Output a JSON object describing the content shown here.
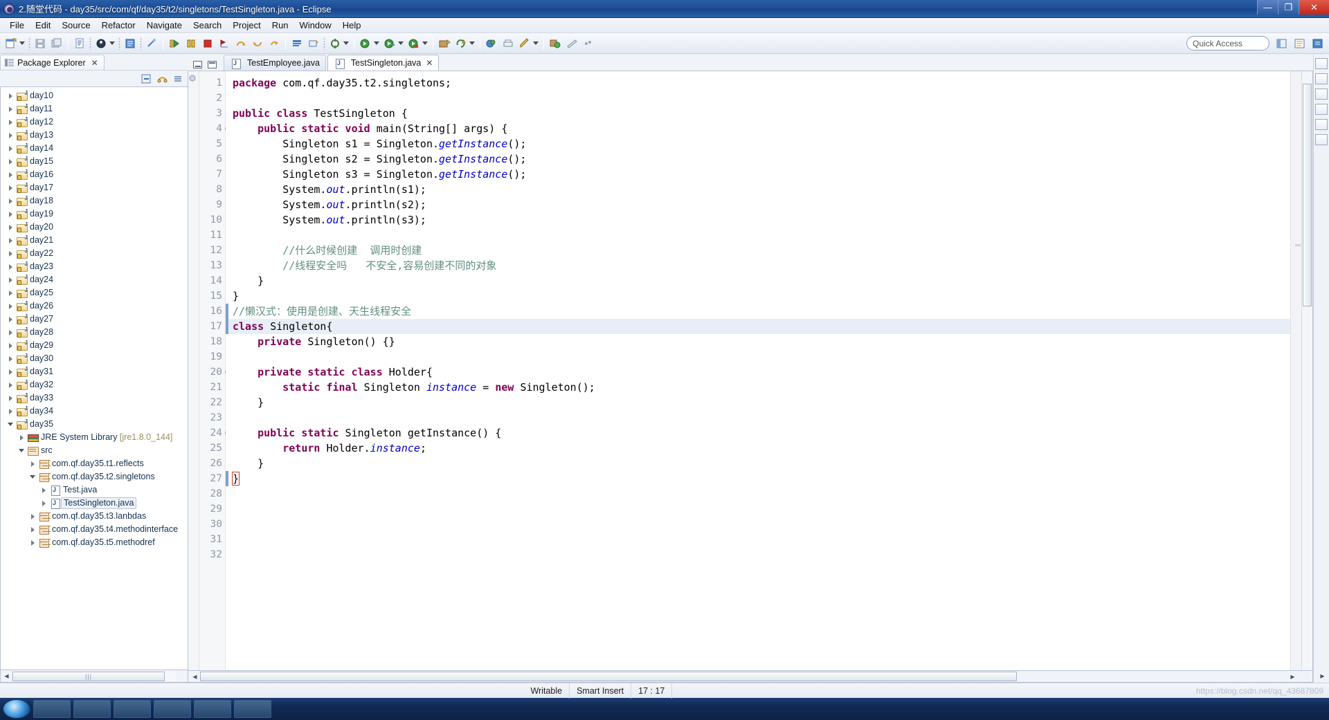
{
  "window": {
    "title": "2.随堂代码 - day35/src/com/qf/day35/t2/singletons/TestSingleton.java - Eclipse",
    "minimize_label": "—",
    "maximize_label": "❐",
    "close_label": "✕"
  },
  "menu": {
    "items": [
      "File",
      "Edit",
      "Source",
      "Refactor",
      "Navigate",
      "Search",
      "Project",
      "Run",
      "Window",
      "Help"
    ]
  },
  "toolbar": {
    "quick_access_placeholder": "Quick Access",
    "icons": [
      "new-wizard-icon",
      "save-icon",
      "save-all-icon",
      "new-java-file-icon",
      "java-perspective-icon",
      "new-class-icon",
      "link-icon",
      "debug-icon",
      "step-icon",
      "terminate-icon",
      "next-annotation-icon",
      "back-icon",
      "forward-icon",
      "refresh-icon",
      "external-tools-icon",
      "build-icon",
      "search-icon",
      "run-icon",
      "run-last-icon",
      "coverage-icon",
      "open-type-icon",
      "open-task-icon",
      "pin-icon",
      "print-icon",
      "edit-icon",
      "open-perspective-icon",
      "ruler-icon",
      "profile-icon",
      "outline-icon",
      "properties-icon",
      "console-icon"
    ],
    "perspective_buttons": [
      "open-perspective-icon",
      "java-perspective-icon",
      "java-ee-perspective-icon"
    ]
  },
  "package_explorer": {
    "title": "Package Explorer",
    "close_label": "✕",
    "view_toolbar": [
      "collapse-all-icon",
      "link-with-editor-icon",
      "view-menu-icon"
    ],
    "tree": [
      {
        "label": "day10",
        "icon": "java-project-icon",
        "indent": 0,
        "state": "collapsed"
      },
      {
        "label": "day11",
        "icon": "java-project-icon",
        "indent": 0,
        "state": "collapsed"
      },
      {
        "label": "day12",
        "icon": "java-project-icon",
        "indent": 0,
        "state": "collapsed"
      },
      {
        "label": "day13",
        "icon": "java-project-icon",
        "indent": 0,
        "state": "collapsed"
      },
      {
        "label": "day14",
        "icon": "java-project-icon",
        "indent": 0,
        "state": "collapsed"
      },
      {
        "label": "day15",
        "icon": "java-project-icon",
        "indent": 0,
        "state": "collapsed"
      },
      {
        "label": "day16",
        "icon": "java-project-icon",
        "indent": 0,
        "state": "collapsed"
      },
      {
        "label": "day17",
        "icon": "java-project-icon",
        "indent": 0,
        "state": "collapsed"
      },
      {
        "label": "day18",
        "icon": "java-project-icon",
        "indent": 0,
        "state": "collapsed"
      },
      {
        "label": "day19",
        "icon": "java-project-icon",
        "indent": 0,
        "state": "collapsed"
      },
      {
        "label": "day20",
        "icon": "java-project-icon",
        "indent": 0,
        "state": "collapsed"
      },
      {
        "label": "day21",
        "icon": "java-project-icon",
        "indent": 0,
        "state": "collapsed"
      },
      {
        "label": "day22",
        "icon": "java-project-icon",
        "indent": 0,
        "state": "collapsed"
      },
      {
        "label": "day23",
        "icon": "java-project-icon",
        "indent": 0,
        "state": "collapsed"
      },
      {
        "label": "day24",
        "icon": "java-project-icon",
        "indent": 0,
        "state": "collapsed"
      },
      {
        "label": "day25",
        "icon": "java-project-icon",
        "indent": 0,
        "state": "collapsed"
      },
      {
        "label": "day26",
        "icon": "java-project-icon",
        "indent": 0,
        "state": "collapsed"
      },
      {
        "label": "day27",
        "icon": "java-project-icon",
        "indent": 0,
        "state": "collapsed"
      },
      {
        "label": "day28",
        "icon": "java-project-icon",
        "indent": 0,
        "state": "collapsed"
      },
      {
        "label": "day29",
        "icon": "java-project-icon",
        "indent": 0,
        "state": "collapsed"
      },
      {
        "label": "day30",
        "icon": "java-project-icon",
        "indent": 0,
        "state": "collapsed"
      },
      {
        "label": "day31",
        "icon": "java-project-icon",
        "indent": 0,
        "state": "collapsed"
      },
      {
        "label": "day32",
        "icon": "java-project-icon",
        "indent": 0,
        "state": "collapsed"
      },
      {
        "label": "day33",
        "icon": "java-project-icon",
        "indent": 0,
        "state": "collapsed"
      },
      {
        "label": "day34",
        "icon": "java-project-icon",
        "indent": 0,
        "state": "collapsed"
      },
      {
        "label": "day35",
        "icon": "java-project-icon",
        "indent": 0,
        "state": "expanded"
      },
      {
        "label": "JRE System Library",
        "suffix": " [jre1.8.0_144]",
        "icon": "jre-library-icon",
        "indent": 1,
        "state": "collapsed"
      },
      {
        "label": "src",
        "icon": "source-folder-icon",
        "indent": 1,
        "state": "expanded"
      },
      {
        "label": "com.qf.day35.t1.reflects",
        "icon": "package-icon",
        "indent": 2,
        "state": "collapsed"
      },
      {
        "label": "com.qf.day35.t2.singletons",
        "icon": "package-icon",
        "indent": 2,
        "state": "expanded"
      },
      {
        "label": "Test.java",
        "icon": "java-file-icon",
        "indent": 3,
        "state": "collapsed"
      },
      {
        "label": "TestSingleton.java",
        "icon": "java-file-icon",
        "indent": 3,
        "state": "collapsed",
        "selected": true
      },
      {
        "label": "com.qf.day35.t3.lanbdas",
        "icon": "package-icon",
        "indent": 2,
        "state": "collapsed"
      },
      {
        "label": "com.qf.day35.t4.methodinterface",
        "icon": "package-icon",
        "indent": 2,
        "state": "collapsed"
      },
      {
        "label": "com.qf.day35.t5.methodref",
        "icon": "package-icon",
        "indent": 2,
        "state": "collapsed"
      }
    ]
  },
  "editor": {
    "tabs": [
      {
        "label": "TestEmployee.java",
        "icon": "java-file-icon",
        "active": false,
        "close_label": ""
      },
      {
        "label": "TestSingleton.java",
        "icon": "java-file-icon",
        "active": true,
        "close_label": "✕"
      }
    ],
    "line_numbers": [
      "1",
      "2",
      "3",
      "4",
      "5",
      "6",
      "7",
      "8",
      "9",
      "10",
      "11",
      "12",
      "13",
      "14",
      "15",
      "16",
      "17",
      "18",
      "19",
      "20",
      "21",
      "22",
      "23",
      "24",
      "25",
      "26",
      "27",
      "28",
      "29",
      "30",
      "31",
      "32"
    ],
    "fold_lines": [
      4,
      20,
      24
    ],
    "highlighted_line": 17,
    "lines": [
      {
        "n": 1,
        "tokens": [
          {
            "t": "package ",
            "c": "kw"
          },
          {
            "t": "com.qf.day35.t2.singletons;",
            "c": "plain"
          }
        ]
      },
      {
        "n": 2,
        "tokens": []
      },
      {
        "n": 3,
        "tokens": [
          {
            "t": "public class ",
            "c": "kw"
          },
          {
            "t": "TestSingleton {",
            "c": "plain"
          }
        ]
      },
      {
        "n": 4,
        "tokens": [
          {
            "t": "    ",
            "c": "plain"
          },
          {
            "t": "public static void ",
            "c": "kw"
          },
          {
            "t": "main(String[] args) {",
            "c": "plain"
          }
        ]
      },
      {
        "n": 5,
        "tokens": [
          {
            "t": "        Singleton s1 = Singleton.",
            "c": "plain"
          },
          {
            "t": "getInstance",
            "c": "stat"
          },
          {
            "t": "();",
            "c": "plain"
          }
        ]
      },
      {
        "n": 6,
        "tokens": [
          {
            "t": "        Singleton s2 = Singleton.",
            "c": "plain"
          },
          {
            "t": "getInstance",
            "c": "stat"
          },
          {
            "t": "();",
            "c": "plain"
          }
        ]
      },
      {
        "n": 7,
        "tokens": [
          {
            "t": "        Singleton s3 = Singleton.",
            "c": "plain"
          },
          {
            "t": "getInstance",
            "c": "stat"
          },
          {
            "t": "();",
            "c": "plain"
          }
        ]
      },
      {
        "n": 8,
        "tokens": [
          {
            "t": "        System.",
            "c": "plain"
          },
          {
            "t": "out",
            "c": "stat"
          },
          {
            "t": ".println(s1);",
            "c": "plain"
          }
        ]
      },
      {
        "n": 9,
        "tokens": [
          {
            "t": "        System.",
            "c": "plain"
          },
          {
            "t": "out",
            "c": "stat"
          },
          {
            "t": ".println(s2);",
            "c": "plain"
          }
        ]
      },
      {
        "n": 10,
        "tokens": [
          {
            "t": "        System.",
            "c": "plain"
          },
          {
            "t": "out",
            "c": "stat"
          },
          {
            "t": ".println(s3);",
            "c": "plain"
          }
        ]
      },
      {
        "n": 11,
        "tokens": []
      },
      {
        "n": 12,
        "tokens": [
          {
            "t": "        //什么时候创建  调用时创建",
            "c": "cmt"
          }
        ]
      },
      {
        "n": 13,
        "tokens": [
          {
            "t": "        //线程安全吗   不安全,容易创建不同的对象",
            "c": "cmt"
          }
        ]
      },
      {
        "n": 14,
        "tokens": [
          {
            "t": "    }",
            "c": "plain"
          }
        ]
      },
      {
        "n": 15,
        "tokens": [
          {
            "t": "}",
            "c": "plain"
          }
        ]
      },
      {
        "n": 16,
        "tokens": [
          {
            "t": "//懒汉式：使用是创建、天生线程安全",
            "c": "cmt"
          }
        ]
      },
      {
        "n": 17,
        "tokens": [
          {
            "t": "class ",
            "c": "kw"
          },
          {
            "t": "Singleton{",
            "c": "plain"
          }
        ]
      },
      {
        "n": 18,
        "tokens": [
          {
            "t": "    ",
            "c": "plain"
          },
          {
            "t": "private ",
            "c": "kw"
          },
          {
            "t": "Singleton() {}",
            "c": "plain"
          }
        ]
      },
      {
        "n": 19,
        "tokens": []
      },
      {
        "n": 20,
        "tokens": [
          {
            "t": "    ",
            "c": "plain"
          },
          {
            "t": "private static class ",
            "c": "kw"
          },
          {
            "t": "Holder{",
            "c": "plain"
          }
        ]
      },
      {
        "n": 21,
        "tokens": [
          {
            "t": "        ",
            "c": "plain"
          },
          {
            "t": "static final ",
            "c": "kw"
          },
          {
            "t": "Singleton ",
            "c": "plain"
          },
          {
            "t": "instance",
            "c": "fld"
          },
          {
            "t": " = ",
            "c": "plain"
          },
          {
            "t": "new ",
            "c": "kw"
          },
          {
            "t": "Singleton();",
            "c": "plain"
          }
        ]
      },
      {
        "n": 22,
        "tokens": [
          {
            "t": "    }",
            "c": "plain"
          }
        ]
      },
      {
        "n": 23,
        "tokens": []
      },
      {
        "n": 24,
        "tokens": [
          {
            "t": "    ",
            "c": "plain"
          },
          {
            "t": "public static ",
            "c": "kw"
          },
          {
            "t": "Singleton getInstance() {",
            "c": "plain"
          }
        ]
      },
      {
        "n": 25,
        "tokens": [
          {
            "t": "        ",
            "c": "plain"
          },
          {
            "t": "return ",
            "c": "kw"
          },
          {
            "t": "Holder.",
            "c": "plain"
          },
          {
            "t": "instance",
            "c": "fld"
          },
          {
            "t": ";",
            "c": "plain"
          }
        ]
      },
      {
        "n": 26,
        "tokens": [
          {
            "t": "    }",
            "c": "plain"
          }
        ]
      },
      {
        "n": 27,
        "tokens": [
          {
            "t": "}",
            "c": "plain"
          }
        ]
      },
      {
        "n": 28,
        "tokens": []
      },
      {
        "n": 29,
        "tokens": []
      },
      {
        "n": 30,
        "tokens": []
      },
      {
        "n": 31,
        "tokens": []
      },
      {
        "n": 32,
        "tokens": []
      }
    ]
  },
  "statusbar": {
    "writable": "Writable",
    "insert_mode": "Smart Insert",
    "position": "17 : 17",
    "watermark": "https://blog.csdn.net/qq_43687809"
  },
  "colors": {
    "keyword": "#7f0055",
    "comment": "#5f8f7d",
    "static_field": "#0000c0",
    "selection": "#e8eef8",
    "titlebar": "#1d4e96",
    "close_button": "#c2271a"
  }
}
